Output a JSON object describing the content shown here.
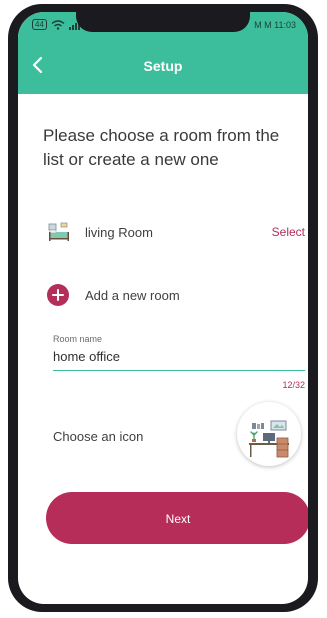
{
  "status_bar": {
    "battery_level": "44",
    "right_text": "M M 11:03"
  },
  "app_bar": {
    "title": "Setup",
    "back_icon": "chevron-left-icon"
  },
  "prompt": "Please choose a room from the list or create a new one",
  "rooms": [
    {
      "label": "living Room",
      "action": "Select",
      "icon": "bed-icon"
    }
  ],
  "add_room": {
    "label": "Add a new room",
    "icon": "plus-icon"
  },
  "room_name_field": {
    "label": "Room name",
    "value": "home office",
    "counter": "12/32"
  },
  "icon_chooser": {
    "label": "Choose an icon",
    "selected_icon": "home-office-desk-icon"
  },
  "next_button": {
    "label": "Next"
  },
  "colors": {
    "accent": "#3cbe9c",
    "primary": "#b52d58"
  }
}
